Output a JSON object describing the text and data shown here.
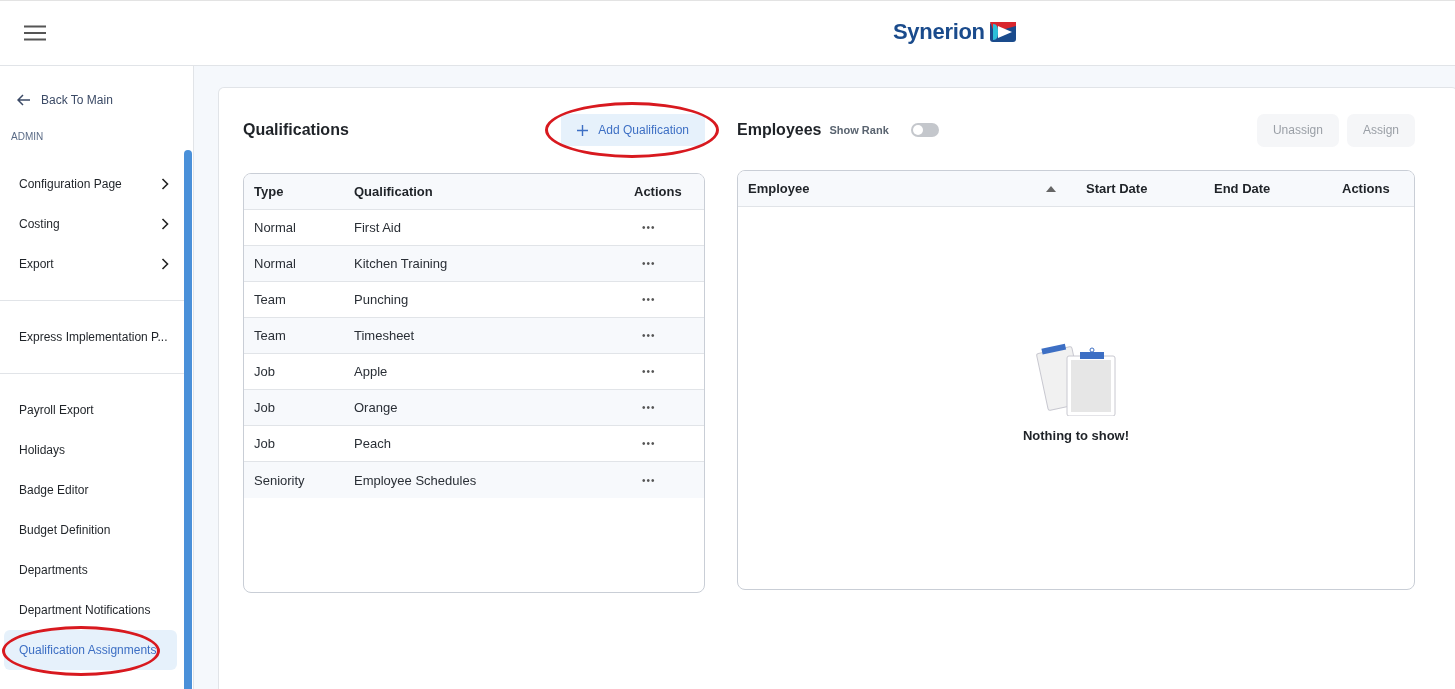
{
  "header": {
    "logo_text": "Synerion"
  },
  "sidebar": {
    "back": "Back To Main",
    "section": "ADMIN",
    "groups": [
      [
        {
          "label": "Configuration Page",
          "expandable": true,
          "selected": false,
          "circled": false
        },
        {
          "label": "Costing",
          "expandable": true,
          "selected": false,
          "circled": false
        },
        {
          "label": "Export",
          "expandable": true,
          "selected": false,
          "circled": false
        }
      ],
      [
        {
          "label": "Express Implementation P...",
          "expandable": false,
          "selected": false,
          "circled": false
        }
      ],
      [
        {
          "label": "Payroll Export",
          "expandable": false,
          "selected": false,
          "circled": false
        },
        {
          "label": "Holidays",
          "expandable": false,
          "selected": false,
          "circled": false
        },
        {
          "label": "Badge Editor",
          "expandable": false,
          "selected": false,
          "circled": false
        },
        {
          "label": "Budget Definition",
          "expandable": false,
          "selected": false,
          "circled": false
        },
        {
          "label": "Departments",
          "expandable": false,
          "selected": false,
          "circled": false
        },
        {
          "label": "Department Notifications",
          "expandable": false,
          "selected": false,
          "circled": false
        },
        {
          "label": "Qualification Assignments",
          "expandable": false,
          "selected": true,
          "circled": true
        }
      ]
    ]
  },
  "qualifications": {
    "title": "Qualifications",
    "add_button": {
      "label": "Add Qualification",
      "circled": true
    },
    "columns": [
      "Type",
      "Qualification",
      "Actions"
    ],
    "rows": [
      {
        "type": "Normal",
        "qualification": "First Aid",
        "actions": "•••"
      },
      {
        "type": "Normal",
        "qualification": "Kitchen Training",
        "actions": "•••"
      },
      {
        "type": "Team",
        "qualification": "Punching",
        "actions": "•••"
      },
      {
        "type": "Team",
        "qualification": "Timesheet",
        "actions": "•••"
      },
      {
        "type": "Job",
        "qualification": "Apple",
        "actions": "•••"
      },
      {
        "type": "Job",
        "qualification": "Orange",
        "actions": "•••"
      },
      {
        "type": "Job",
        "qualification": "Peach",
        "actions": "•••"
      },
      {
        "type": "Seniority",
        "qualification": "Employee Schedules",
        "actions": "•••"
      }
    ]
  },
  "employees": {
    "title": "Employees",
    "show_rank": {
      "label": "Show Rank",
      "on": false
    },
    "buttons": [
      {
        "label": "Unassign",
        "disabled": true
      },
      {
        "label": "Assign",
        "disabled": true
      }
    ],
    "columns": [
      {
        "label": "Employee",
        "sorted": true
      },
      {
        "label": "Start Date",
        "sorted": false
      },
      {
        "label": "End Date",
        "sorted": false
      },
      {
        "label": "Actions",
        "sorted": false
      }
    ],
    "empty_message": "Nothing to show!"
  }
}
